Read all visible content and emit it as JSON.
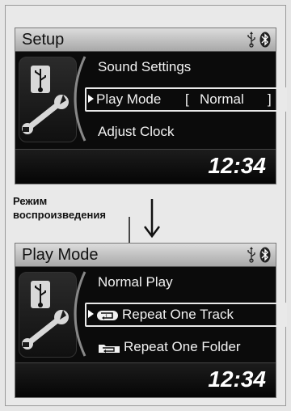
{
  "screen1": {
    "title": "Setup",
    "menu": [
      {
        "label": "Sound Settings"
      },
      {
        "label": "Play Mode",
        "value_open": "[",
        "value": "Normal",
        "value_close": "]",
        "selected": true
      },
      {
        "label": "Adjust Clock"
      }
    ],
    "clock": "12:34"
  },
  "caption": {
    "line1": "Режим",
    "line2": "воспроизведения"
  },
  "screen2": {
    "title": "Play Mode",
    "menu": [
      {
        "label": "Normal Play"
      },
      {
        "label": "Repeat One Track",
        "icon": "repeat-one-track-icon",
        "selected": true
      },
      {
        "label": "Repeat One Folder",
        "icon": "repeat-folder-icon"
      }
    ],
    "clock": "12:34"
  },
  "status_icons": [
    "usb-icon",
    "bluetooth-icon"
  ],
  "colors": {
    "screen_bg": "#0b0b0b",
    "title_bar": "#c8c8c8",
    "text": "#f2f2f2"
  }
}
